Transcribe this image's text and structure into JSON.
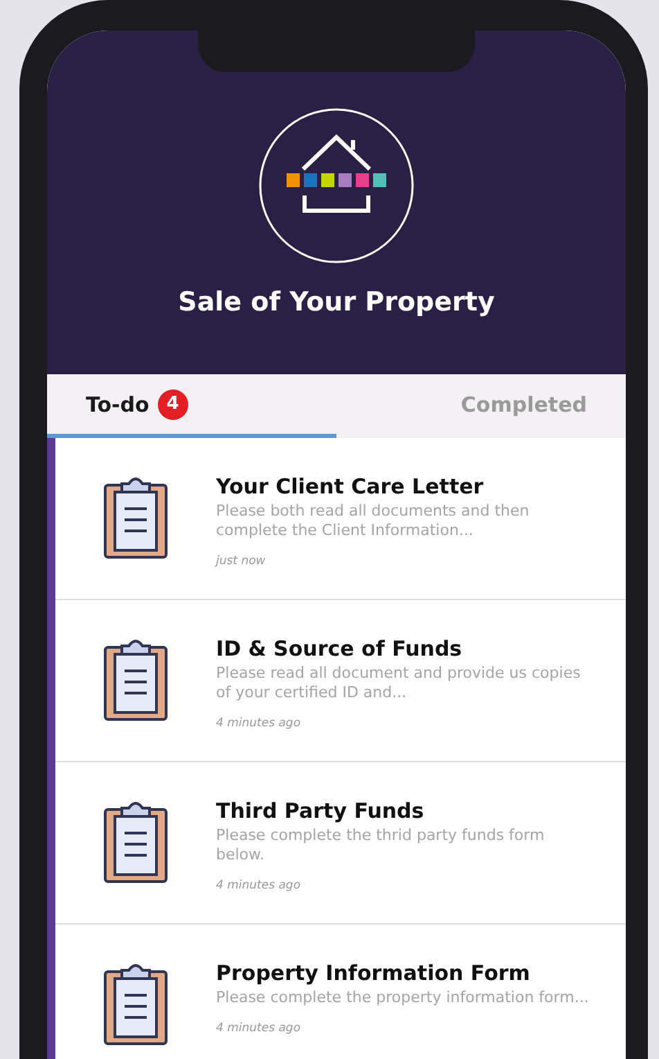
{
  "header": {
    "title": "Sale of Your Property"
  },
  "tabs": [
    {
      "label": "To-do",
      "selected": true,
      "badge": "4"
    },
    {
      "label": "Completed",
      "selected": false
    }
  ],
  "tasks": [
    {
      "title": "Your Client Care Letter",
      "description": "Please both read all documents and then complete the Client Information...",
      "time": "just now"
    },
    {
      "title": "ID & Source of Funds",
      "description": "Please read all document and provide us copies of your certified ID and...",
      "time": "4 minutes ago"
    },
    {
      "title": "Third Party Funds",
      "description": "Please complete the thrid party funds form below.",
      "time": "4 minutes ago"
    },
    {
      "title": "Property Information Form",
      "description": "Please complete the property information form...",
      "time": "4 minutes ago"
    }
  ]
}
